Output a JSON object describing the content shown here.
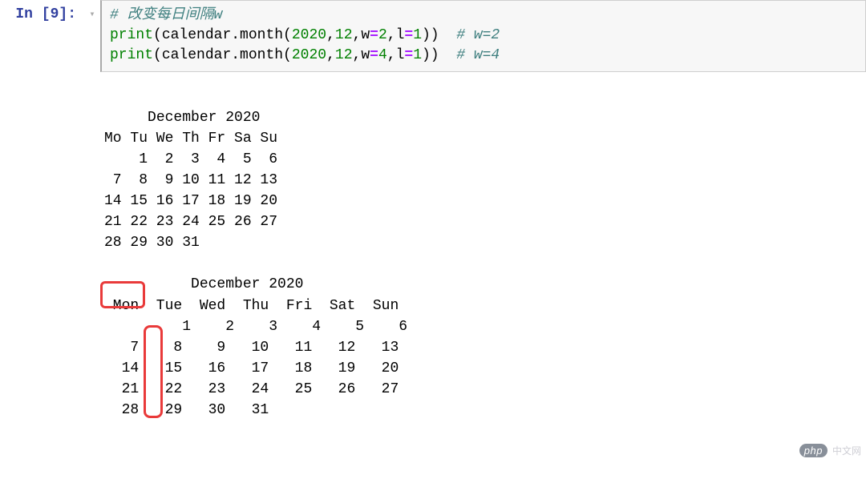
{
  "prompt": {
    "label_pre": "In [",
    "number": "9",
    "label_post": "]:"
  },
  "code": {
    "line1_comment": "# 改变每日间隔w",
    "line2_builtin": "print",
    "line2_open": "(",
    "line2_call": "calendar.month(",
    "line2_n1": "2020",
    "line2_c1": ",",
    "line2_n2": "12",
    "line2_c2": ",",
    "line2_p1": "w",
    "line2_eq1": "=",
    "line2_v1": "2",
    "line2_c3": ",",
    "line2_p2": "l",
    "line2_eq2": "=",
    "line2_v2": "1",
    "line2_close": "))",
    "line2_comment": "  # w=2",
    "line3_builtin": "print",
    "line3_open": "(",
    "line3_call": "calendar.month(",
    "line3_n1": "2020",
    "line3_c1": ",",
    "line3_n2": "12",
    "line3_c2": ",",
    "line3_p1": "w",
    "line3_eq1": "=",
    "line3_v1": "4",
    "line3_c3": ",",
    "line3_p2": "l",
    "line3_eq2": "=",
    "line3_v2": "1",
    "line3_close": "))",
    "line3_comment": "  # w=4"
  },
  "output": {
    "text": "   December 2020\nMo Tu We Th Fr Sa Su\n    1  2  3  4  5  6\n 7  8  9 10 11 12 13\n14 15 16 17 18 19 20\n21 22 23 24 25 26 27\n28 29 30 31\n\n          December 2020\n Mon  Tue  Wed  Thu  Fri  Sat  Sun\n         1    2    3    4    5    6\n   7    8    9   10   11   12   13\n  14   15   16   17   18   19   20\n  21   22   23   24   25   26   27\n  28   29   30   31"
  },
  "watermark": {
    "badge": "php",
    "text": "中文网"
  }
}
